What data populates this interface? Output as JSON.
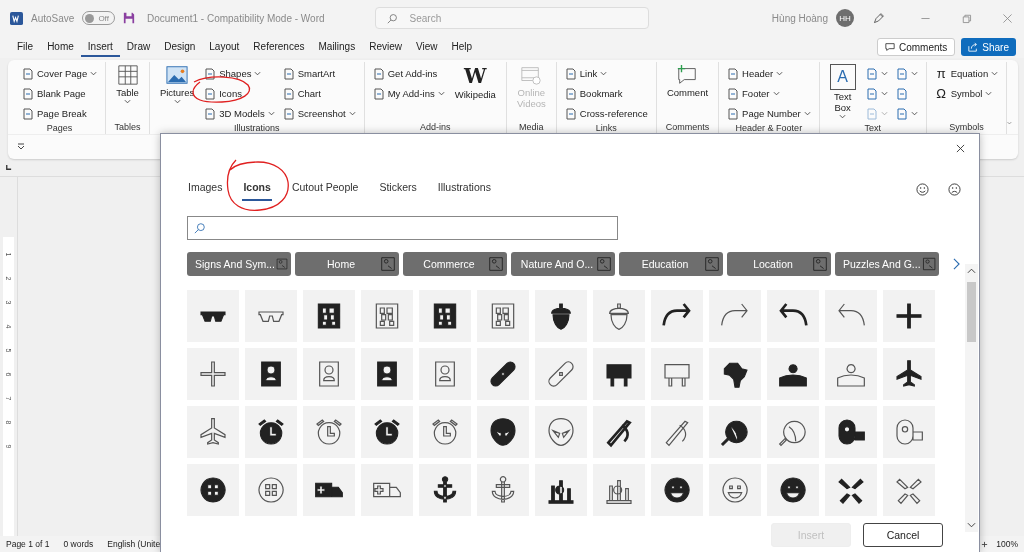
{
  "window": {
    "autosave_label": "AutoSave",
    "autosave": {
      "on": false,
      "label": "Off"
    },
    "title": "Document1  -  Compatibility Mode  -  Word",
    "search": {
      "placeholder": "Search"
    },
    "user": "Hùng Hoàng",
    "avatar": "HH"
  },
  "menu_tabs": [
    {
      "label": "File",
      "selected": false
    },
    {
      "label": "Home",
      "selected": false
    },
    {
      "label": "Insert",
      "selected": true
    },
    {
      "label": "Draw",
      "selected": false
    },
    {
      "label": "Design",
      "selected": false
    },
    {
      "label": "Layout",
      "selected": false
    },
    {
      "label": "References",
      "selected": false
    },
    {
      "label": "Mailings",
      "selected": false
    },
    {
      "label": "Review",
      "selected": false
    },
    {
      "label": "View",
      "selected": false
    },
    {
      "label": "Help",
      "selected": false
    }
  ],
  "comments_button": "Comments",
  "share_button": "Share",
  "ribbon": {
    "groups": [
      {
        "label": "Pages",
        "items": [
          {
            "kind": "small",
            "label": "Cover Page",
            "dropdown": true
          },
          {
            "kind": "small",
            "label": "Blank Page",
            "dropdown": false
          },
          {
            "kind": "small",
            "label": "Page Break",
            "dropdown": false
          }
        ]
      },
      {
        "label": "Tables",
        "items": [
          {
            "kind": "large",
            "label": "Table",
            "dropdown": true
          }
        ]
      },
      {
        "label": "Illustrations",
        "items": [
          {
            "kind": "large",
            "label": "Pictures",
            "dropdown": true
          },
          {
            "kind": "small",
            "label": "Shapes",
            "dropdown": true
          },
          {
            "kind": "small",
            "label": "Icons",
            "dropdown": false
          },
          {
            "kind": "small",
            "label": "3D Models",
            "dropdown": true
          },
          {
            "kind": "small",
            "label": "SmartArt",
            "dropdown": false
          },
          {
            "kind": "small",
            "label": "Chart",
            "dropdown": false
          },
          {
            "kind": "small",
            "label": "Screenshot",
            "dropdown": true
          }
        ]
      },
      {
        "label": "Add-ins",
        "items": [
          {
            "kind": "small",
            "label": "Get Add-ins",
            "dropdown": false
          },
          {
            "kind": "small",
            "label": "My Add-ins",
            "dropdown": true
          },
          {
            "kind": "large",
            "label": "Wikipedia",
            "glyph": "W",
            "dropdown": false
          }
        ]
      },
      {
        "label": "Media",
        "items": [
          {
            "kind": "large",
            "label": "Online Videos",
            "dropdown": false,
            "disabled": true
          }
        ]
      },
      {
        "label": "Links",
        "items": [
          {
            "kind": "small",
            "label": "Link",
            "dropdown": true
          },
          {
            "kind": "small",
            "label": "Bookmark",
            "dropdown": false
          },
          {
            "kind": "small",
            "label": "Cross-reference",
            "dropdown": false
          }
        ]
      },
      {
        "label": "Comments",
        "items": [
          {
            "kind": "large",
            "label": "Comment",
            "dropdown": false
          }
        ]
      },
      {
        "label": "Header & Footer",
        "items": [
          {
            "kind": "small",
            "label": "Header",
            "dropdown": true
          },
          {
            "kind": "small",
            "label": "Footer",
            "dropdown": true
          },
          {
            "kind": "small",
            "label": "Page Number",
            "dropdown": true
          }
        ]
      },
      {
        "label": "Text",
        "items": [
          {
            "kind": "large",
            "label": "Text Box",
            "glyph": "A",
            "dropdown": true
          },
          {
            "kind": "icon",
            "dropdown": true
          },
          {
            "kind": "icon",
            "dropdown": true
          },
          {
            "kind": "icon",
            "dropdown": true,
            "disabled": true
          },
          {
            "kind": "icon",
            "dropdown": true
          },
          {
            "kind": "icon",
            "dropdown": false
          },
          {
            "kind": "icon",
            "dropdown": true
          }
        ]
      },
      {
        "label": "Symbols",
        "items": [
          {
            "kind": "small",
            "label": "Equation",
            "glyph": "π",
            "dropdown": true
          },
          {
            "kind": "small",
            "label": "Symbol",
            "glyph": "Ω",
            "dropdown": true
          }
        ]
      }
    ]
  },
  "ruler": [
    "1",
    "2",
    "3",
    "4",
    "5",
    "6",
    "7",
    "8",
    "9"
  ],
  "status_bar": {
    "page": "Page 1 of 1",
    "words": "0 words",
    "language": "English (Unite",
    "zoom": "100%"
  },
  "dialog": {
    "tabs": [
      {
        "label": "Images",
        "selected": false
      },
      {
        "label": "Icons",
        "selected": true
      },
      {
        "label": "Cutout People",
        "selected": false
      },
      {
        "label": "Stickers",
        "selected": false
      },
      {
        "label": "Illustrations",
        "selected": false
      }
    ],
    "categories": [
      "Signs And Sym...",
      "Home",
      "Commerce",
      "Nature And O...",
      "Education",
      "Location",
      "Puzzles And G..."
    ],
    "buttons": [
      {
        "label": "Insert",
        "disabled": true
      },
      {
        "label": "Cancel",
        "disabled": false
      }
    ]
  }
}
